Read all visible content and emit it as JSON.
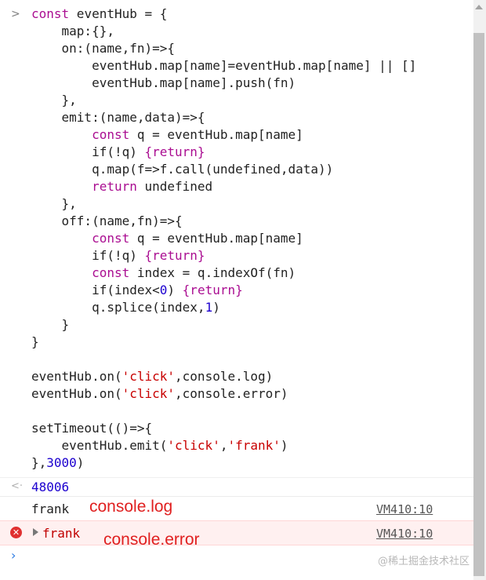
{
  "code_lines": [
    "const eventHub = {",
    "    map:{},",
    "    on:(name,fn)=>{",
    "        eventHub.map[name]=eventHub.map[name] || []",
    "        eventHub.map[name].push(fn)",
    "    },",
    "    emit:(name,data)=>{",
    "        const q = eventHub.map[name]",
    "        if(!q) {return}",
    "        q.map(f=>f.call(undefined,data))",
    "        return undefined",
    "    },",
    "    off:(name,fn)=>{",
    "        const q = eventHub.map[name]",
    "        if(!q) {return}",
    "        const index = q.indexOf(fn)",
    "        if(index<0) {return}",
    "        q.splice(index,1)",
    "    }",
    "}",
    "",
    "eventHub.on('click',console.log)",
    "eventHub.on('click',console.error)",
    "",
    "setTimeout(()=>{",
    "    eventHub.emit('click','frank')",
    "},3000)"
  ],
  "result": {
    "value": "48006"
  },
  "log_row": {
    "text": "frank",
    "source": "VM410:10",
    "annotation": "console.log"
  },
  "error_row": {
    "text": "frank",
    "source": "VM410:10",
    "annotation": "console.error",
    "icon": "error-icon"
  },
  "watermark": "@稀土掘金技术社区",
  "colors": {
    "keyword": "#aa0d91",
    "string": "#c80000",
    "number": "#1c00cf",
    "annotation": "#e02020",
    "error_bg": "#fff0f0"
  }
}
